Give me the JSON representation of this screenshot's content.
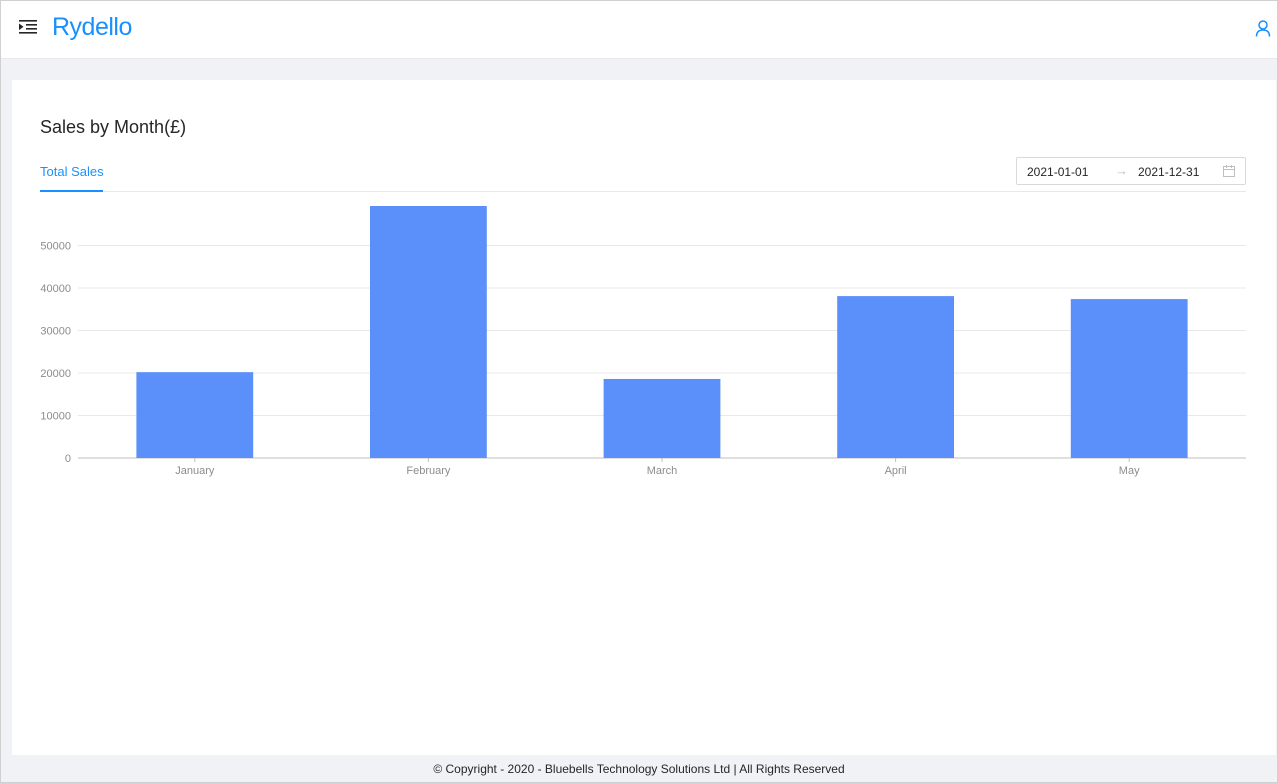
{
  "header": {
    "logo": "Rydello",
    "menu_icon": "menu-fold-icon",
    "user_icon": "user-icon"
  },
  "card": {
    "title": "Sales by Month(£)",
    "tabs": [
      {
        "label": "Total Sales",
        "active": true
      }
    ],
    "date_range": {
      "start": "2021-01-01",
      "separator": "→",
      "end": "2021-12-31",
      "icon": "calendar-icon"
    }
  },
  "chart_data": {
    "type": "bar",
    "categories": [
      "January",
      "February",
      "March",
      "April",
      "May"
    ],
    "values": [
      20200,
      59300,
      18600,
      38100,
      37400
    ],
    "ylim": [
      0,
      59300
    ],
    "yticks": [
      0,
      10000,
      20000,
      30000,
      40000,
      50000
    ],
    "grid": true,
    "bar_color": "#5b8ff9"
  },
  "footer": {
    "text": "© Copyright - 2020 - Bluebells Technology Solutions Ltd | All Rights Reserved"
  },
  "colors": {
    "accent": "#1890ff",
    "bar": "#5b8ff9"
  }
}
